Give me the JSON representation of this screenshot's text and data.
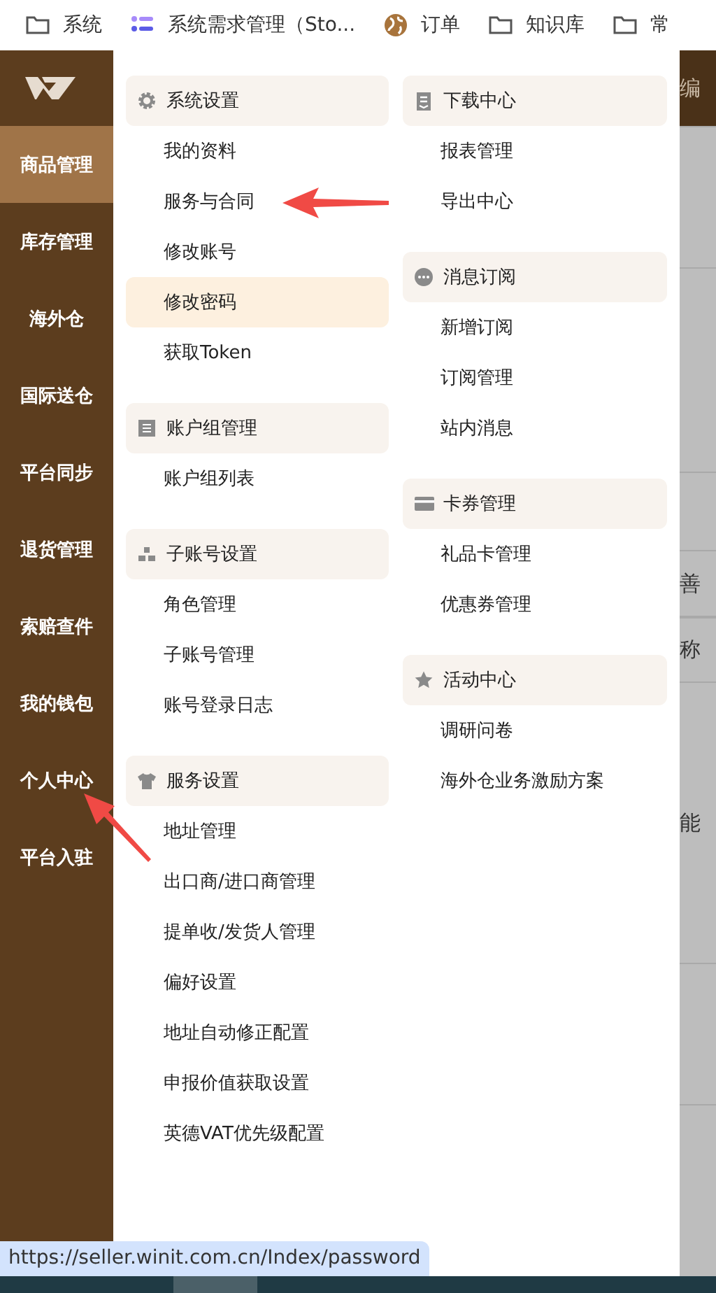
{
  "bookmarks": [
    {
      "kind": "folder",
      "label": "系统"
    },
    {
      "kind": "list",
      "label": "系统需求管理（Sto..."
    },
    {
      "kind": "globe",
      "label": "订单"
    },
    {
      "kind": "folder",
      "label": "知识库"
    },
    {
      "kind": "folder",
      "label": "常"
    }
  ],
  "sidebar": {
    "items": [
      {
        "label": "商品管理",
        "selected": true
      },
      {
        "label": "库存管理",
        "selected": false
      },
      {
        "label": "海外仓",
        "selected": false
      },
      {
        "label": "国际送仓",
        "selected": false
      },
      {
        "label": "平台同步",
        "selected": false
      },
      {
        "label": "退货管理",
        "selected": false
      },
      {
        "label": "索赔查件",
        "selected": false
      },
      {
        "label": "我的钱包",
        "selected": false
      },
      {
        "label": "个人中心",
        "selected": false
      },
      {
        "label": "平台入驻",
        "selected": false
      }
    ]
  },
  "menu": {
    "columns": [
      [
        {
          "kind": "gear",
          "title": "系统设置",
          "items": [
            {
              "label": "我的资料",
              "selected": false
            },
            {
              "label": "服务与合同",
              "selected": false
            },
            {
              "label": "修改账号",
              "selected": false
            },
            {
              "label": "修改密码",
              "selected": true
            },
            {
              "label": "获取Token",
              "selected": false
            }
          ]
        },
        {
          "kind": "list",
          "title": "账户组管理",
          "items": [
            {
              "label": "账户组列表",
              "selected": false
            }
          ]
        },
        {
          "kind": "people",
          "title": "子账号设置",
          "items": [
            {
              "label": "角色管理",
              "selected": false
            },
            {
              "label": "子账号管理",
              "selected": false
            },
            {
              "label": "账号登录日志",
              "selected": false
            }
          ]
        },
        {
          "kind": "shirt",
          "title": "服务设置",
          "items": [
            {
              "label": "地址管理",
              "selected": false
            },
            {
              "label": "出口商/进口商管理",
              "selected": false
            },
            {
              "label": "提单收/发货人管理",
              "selected": false
            },
            {
              "label": "偏好设置",
              "selected": false
            },
            {
              "label": "地址自动修正配置",
              "selected": false
            },
            {
              "label": "申报价值获取设置",
              "selected": false
            },
            {
              "label": "英德VAT优先级配置",
              "selected": false
            }
          ]
        }
      ],
      [
        {
          "kind": "download",
          "title": "下载中心",
          "items": [
            {
              "label": "报表管理",
              "selected": false
            },
            {
              "label": "导出中心",
              "selected": false
            }
          ]
        },
        {
          "kind": "chat",
          "title": "消息订阅",
          "items": [
            {
              "label": "新增订阅",
              "selected": false
            },
            {
              "label": "订阅管理",
              "selected": false
            },
            {
              "label": "站内消息",
              "selected": false
            }
          ]
        },
        {
          "kind": "card",
          "title": "卡券管理",
          "items": [
            {
              "label": "礼品卡管理",
              "selected": false
            },
            {
              "label": "优惠券管理",
              "selected": false
            }
          ]
        },
        {
          "kind": "star",
          "title": "活动中心",
          "items": [
            {
              "label": "调研问卷",
              "selected": false
            },
            {
              "label": "海外仓业务激励方案",
              "selected": false
            }
          ]
        }
      ]
    ]
  },
  "background_texts": [
    "编",
    "善",
    "称",
    "能"
  ],
  "status_url": "https://seller.winit.com.cn/Index/password"
}
